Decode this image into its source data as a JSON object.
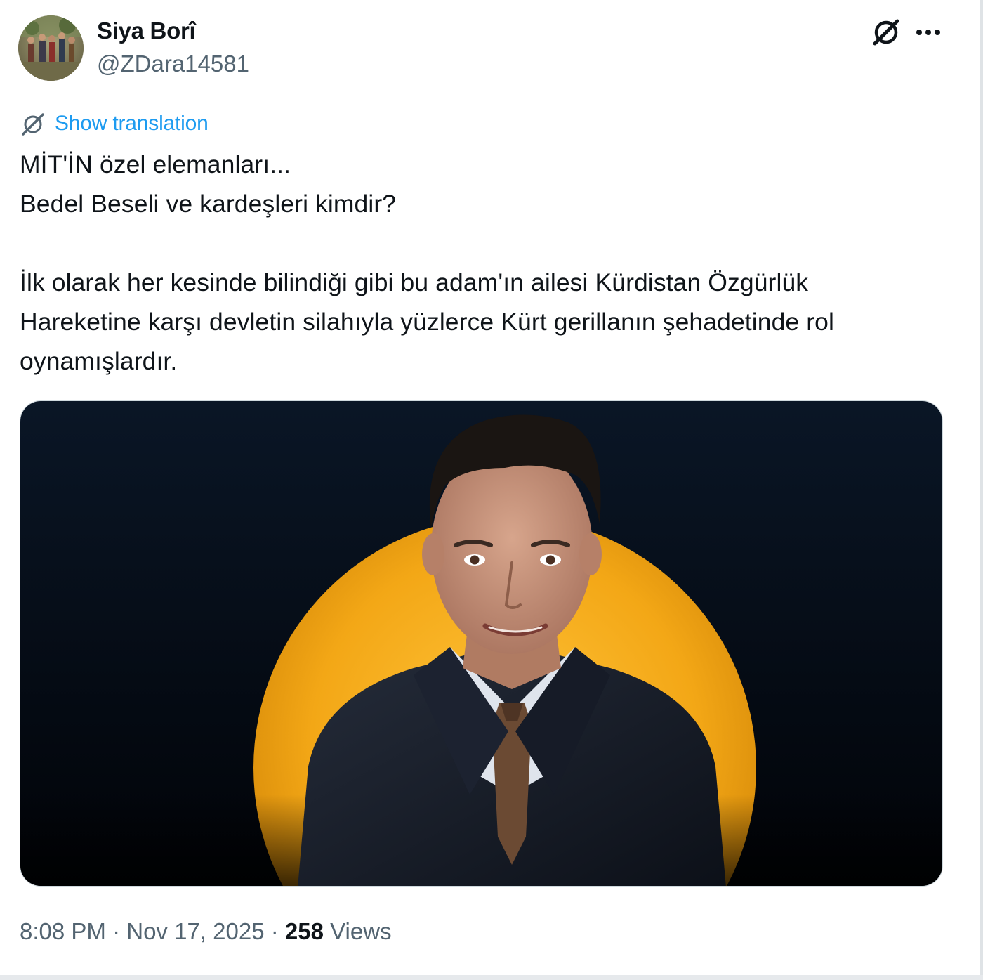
{
  "author": {
    "display_name": "Siya Borî",
    "handle": "@ZDara14581",
    "avatar_icon": "profile-photo"
  },
  "actions": {
    "grok_icon": "grok-icon",
    "more_icon": "more-options-icon"
  },
  "translation": {
    "label": "Show translation",
    "icon": "translate-icon",
    "color": "#1d9bf0"
  },
  "tweet": {
    "line1": "MİT'İN özel elemanları...",
    "line2": "Bedel Beseli ve kardeşleri kimdir?",
    "line3": "İlk olarak her kesinde bilindiği gibi bu adam'ın ailesi Kürdistan Özgürlük",
    "line4": "Hareketine karşı devletin silahıyla yüzlerce Kürt gerillanın şehadetinde rol",
    "line5": "oynamışlardır."
  },
  "media": {
    "description_icon": "portrait-photo",
    "background_color": "#05101f",
    "accent_color": "#f5ad1c"
  },
  "meta": {
    "time": "8:08 PM",
    "separator": "·",
    "date": "Nov 17, 2025",
    "views_count": "258",
    "views_label": "Views"
  }
}
